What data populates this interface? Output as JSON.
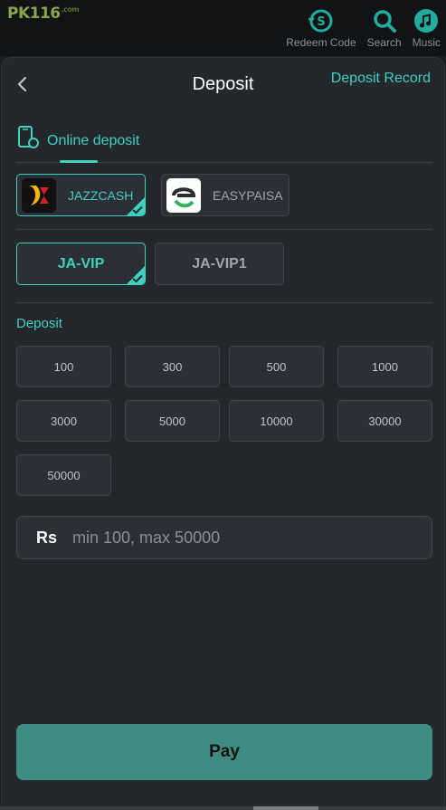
{
  "header": {
    "logo_text": "PK116",
    "logo_sub": ".com",
    "actions": [
      {
        "label": "Redeem Code",
        "icon": "redeem-icon"
      },
      {
        "label": "Search",
        "icon": "search-icon"
      },
      {
        "label": "Music",
        "icon": "music-icon"
      }
    ]
  },
  "page": {
    "title": "Deposit",
    "record_link": "Deposit Record",
    "back_icon": "chevron-left-icon"
  },
  "tabs": [
    {
      "label": "Online deposit",
      "icon": "phone-icon",
      "active": true
    }
  ],
  "methods": [
    {
      "label": "JAZZCASH",
      "active": true
    },
    {
      "label": "EASYPAISA",
      "active": false
    }
  ],
  "channels": [
    {
      "label": "JA-VIP",
      "active": true
    },
    {
      "label": "JA-VIP1",
      "active": false
    }
  ],
  "deposit_label": "Deposit",
  "amounts": [
    "100",
    "300",
    "500",
    "1000",
    "3000",
    "5000",
    "10000",
    "30000",
    "50000"
  ],
  "amount_input": {
    "currency": "Rs",
    "placeholder": "min 100, max 50000",
    "value": ""
  },
  "pay_button": "Pay",
  "colors": {
    "accent": "#3fd0c0",
    "pay": "#3d8b81",
    "background": "#24272c"
  }
}
